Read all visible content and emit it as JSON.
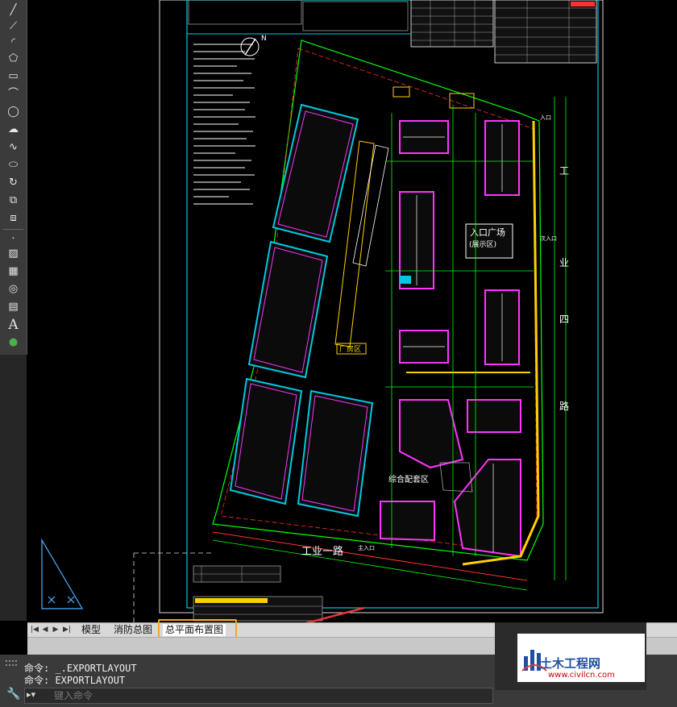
{
  "colors": {
    "background": "#000000",
    "drawing_frame": "#00c8e0",
    "building_outline": "#ff33ff",
    "road_line": "#00ff00",
    "annotation_red": "#ff3030",
    "highlight_yellow": "#ffd000",
    "tab_highlight": "#f5a623",
    "arrow": "#e53935"
  },
  "toolbar": {
    "tools": [
      "line-icon",
      "polyline-icon",
      "arc-icon",
      "polygon-icon",
      "rectangle-icon",
      "spline-icon",
      "circle-icon",
      "revcloud-icon",
      "curve-icon",
      "ellipse-icon",
      "rotate-icon",
      "insert-block-icon",
      "point-icon",
      "hatch-icon",
      "gradient-icon",
      "region-icon",
      "table-icon",
      "text-icon",
      "multitext-icon"
    ]
  },
  "drawing": {
    "labels": {
      "plaza": "入口广场",
      "plaza_sub": "(展示区)",
      "factory": "厂房区",
      "facility": "综合配套区",
      "road_bottom": "工业一路",
      "road_right_top": "工",
      "road_right_mid": "业",
      "road_right_low": "四",
      "road_right_bottom": "路",
      "entry_top_right": "入口",
      "entry_mid_right": "次入口",
      "entry_bottom": "主入口",
      "north_mark": "N"
    }
  },
  "tabs": {
    "nav": [
      "|◀",
      "◀",
      "▶",
      "▶|"
    ],
    "items": [
      {
        "label": "模型",
        "active": false
      },
      {
        "label": "消防总图",
        "active": false
      },
      {
        "label": "总平面布置图",
        "active": true
      }
    ]
  },
  "command": {
    "history": [
      "命令: _.EXPORTLAYOUT",
      "命令: EXPORTLAYOUT"
    ],
    "placeholder": "键入命令"
  },
  "watermark": {
    "title": "土木工程网",
    "url": "www.civilcn.com"
  }
}
